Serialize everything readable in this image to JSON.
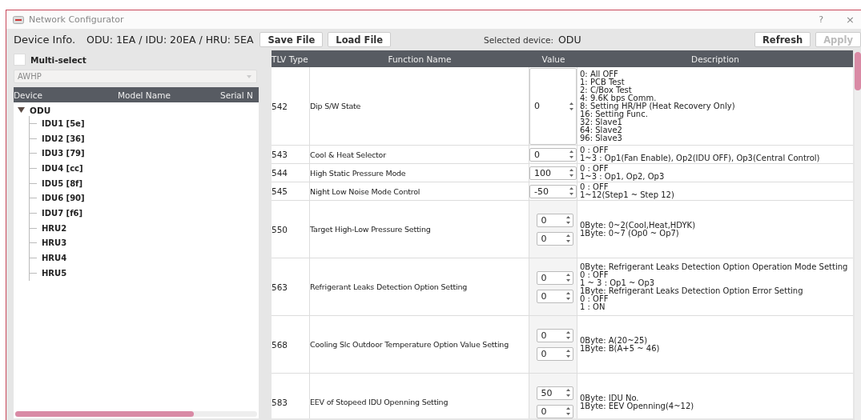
{
  "window": {
    "title": "Network Configurator",
    "help": "?",
    "close": "×"
  },
  "toolbar": {
    "device_info_label": "Device Info.",
    "device_info": "ODU: 1EA / IDU: 20EA / HRU: 5EA",
    "buttons": [
      {
        "label": "Save File",
        "disabled": false
      },
      {
        "label": "Load File",
        "disabled": false
      }
    ],
    "selected_device_label": "Selected device:",
    "selected_device": "ODU",
    "right_buttons": [
      {
        "label": "Refresh",
        "disabled": false
      },
      {
        "label": "Apply",
        "disabled": true
      }
    ]
  },
  "sidebar": {
    "multi_select": {
      "label": "Multi-select",
      "checked": false
    },
    "dropdown": {
      "value": "AWHP",
      "disabled": true
    },
    "columns": [
      "Device",
      "Model Name",
      "Serial N"
    ],
    "tree": [
      {
        "label": "ODU",
        "expanded": true,
        "children": [
          {
            "label": "IDU1 [5e]"
          },
          {
            "label": "IDU2 [36]"
          },
          {
            "label": "IDU3 [79]"
          },
          {
            "label": "IDU4 [cc]"
          },
          {
            "label": "IDU5 [8f]"
          },
          {
            "label": "IDU6 [90]"
          },
          {
            "label": "IDU7 [f6]"
          },
          {
            "label": "HRU2"
          },
          {
            "label": "HRU3"
          },
          {
            "label": "HRU4"
          },
          {
            "label": "HRU5"
          }
        ]
      }
    ]
  },
  "table": {
    "columns": [
      "TLV Type",
      "Function Name",
      "Value",
      "Description"
    ],
    "rows": [
      {
        "tlv": "542",
        "name": "Dip S/W State",
        "kind": "tall",
        "values": [
          "0"
        ],
        "description": [
          "0: All OFF",
          "1: PCB Test",
          "2: C/Box Test",
          "4: 9.6K bps Comm.",
          "8: Setting HR/HP (Heat Recovery Only)",
          "16: Setting Func.",
          "32: Slave1",
          "64: Slave2",
          "96: Slave3"
        ]
      },
      {
        "tlv": "543",
        "name": "Cool & Heat Selector",
        "kind": "spin",
        "values": [
          "0"
        ],
        "description": [
          "0 : OFF",
          "1~3 : Op1(Fan Enable), Op2(IDU OFF), Op3(Central Control)"
        ]
      },
      {
        "tlv": "544",
        "name": "High Static Pressure Mode",
        "kind": "spin",
        "values": [
          "100"
        ],
        "description": [
          "0 : OFF",
          "1~3 : Op1, Op2, Op3"
        ]
      },
      {
        "tlv": "545",
        "name": "Night Low Noise Mode Control",
        "kind": "spin",
        "values": [
          "-50"
        ],
        "description": [
          "0 : OFF",
          "1~12(Step1 ~ Step 12)"
        ]
      },
      {
        "tlv": "550",
        "name": "Target High-Low Pressure Setting",
        "kind": "pair",
        "values": [
          "0",
          "0"
        ],
        "description": [
          "0Byte: 0~2(Cool,Heat,HDYK)",
          "1Byte: 0~7 (Op0 ~ Op7)"
        ]
      },
      {
        "tlv": "563",
        "name": "Refrigerant Leaks Detection Option Setting",
        "kind": "pair",
        "values": [
          "0",
          "0"
        ],
        "description": [
          "0Byte: Refrigerant Leaks Detection Option Operation Mode Setting",
          "0 : OFF",
          "1 ~ 3 : Op1 ~ Op3",
          "1Byte: Refrigerant Leaks Detection Option Error Setting",
          "0 : OFF",
          "1 : ON"
        ]
      },
      {
        "tlv": "568",
        "name": "Cooling Slc Outdoor Temperature Option Value Setting",
        "kind": "pair",
        "values": [
          "0",
          "0"
        ],
        "description": [
          "0Byte: A(20~25)",
          "1Byte: B(A+5 ~ 46)"
        ]
      },
      {
        "tlv": "583",
        "name": "EEV of Stopeed IDU Openning Setting",
        "kind": "pair",
        "values": [
          "50",
          "0"
        ],
        "description": [
          "0Byte: IDU No.",
          "1Byte: EEV Openning(4~12)"
        ]
      }
    ]
  }
}
